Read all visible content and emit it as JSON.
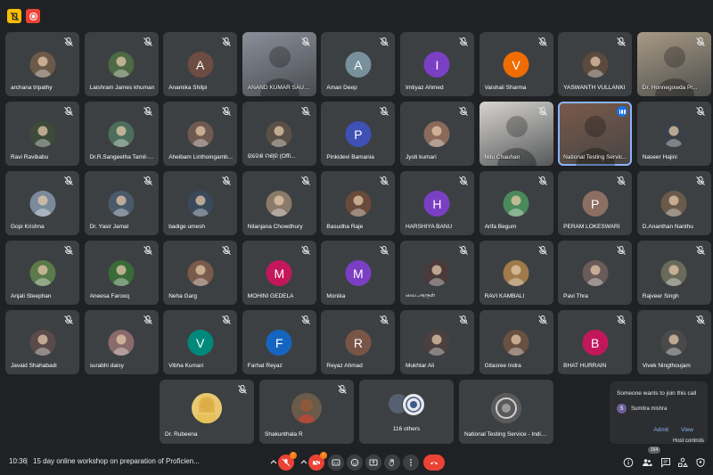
{
  "top_icons": [
    {
      "icon": "raised-hand-slash-icon",
      "color": "#fbbc04"
    },
    {
      "icon": "recording-icon",
      "color": "#ea4335"
    }
  ],
  "participants": [
    {
      "name": "archana tripathy",
      "avatar": "photo",
      "color": "#6b5a48"
    },
    {
      "name": "Laishram James khuman",
      "avatar": "photo",
      "color": "#4c6a44"
    },
    {
      "name": "Anamika Shilpi",
      "avatar": "A",
      "color": "#6d4c41"
    },
    {
      "name": "ANAND KUMAR SAURA...",
      "avatar": "video",
      "color": "#8a8e99"
    },
    {
      "name": "Aman Deep",
      "avatar": "A",
      "color": "#78909c"
    },
    {
      "name": "Imtiyaz Ahmed",
      "avatar": "I",
      "color": "#7b3fc4"
    },
    {
      "name": "Vaishali Sharma",
      "avatar": "V",
      "color": "#ef6c00"
    },
    {
      "name": "YASWANTH VULLANKI",
      "avatar": "photo",
      "color": "#5b4a3d"
    },
    {
      "name": "Dr. Honnegowda Pr...",
      "avatar": "video",
      "color": "#a89a84"
    },
    {
      "name": "Ravi Ravibabu",
      "avatar": "photo",
      "color": "#3e4a3a"
    },
    {
      "name": "Dr.R.Sangeetha Tamil-SF",
      "avatar": "photo",
      "color": "#4c6e5a"
    },
    {
      "name": "Aheibam Linthoingamb...",
      "avatar": "photo",
      "color": "#6e5a50"
    },
    {
      "name": "ରାଜେଶ ମିଶ୍ର (Offi...",
      "avatar": "photo",
      "color": "#5a5045"
    },
    {
      "name": "Pinkidevi Bamania",
      "avatar": "P",
      "color": "#3f51b5"
    },
    {
      "name": "Jyoti kumari",
      "avatar": "photo",
      "color": "#8a6a5a"
    },
    {
      "name": "Nitu Chauhan",
      "avatar": "video",
      "color": "#d7d4d0"
    },
    {
      "name": "National Testing Servic...",
      "avatar": "video",
      "color": "#7a5a4a"
    },
    {
      "name": "Naseer Hajini",
      "avatar": "photo",
      "color": "#3a4048"
    },
    {
      "name": "Gopi Krishna",
      "avatar": "photo",
      "color": "#7a8a9a"
    },
    {
      "name": "Dr. Yasir Jamal",
      "avatar": "photo",
      "color": "#4a5a6a"
    },
    {
      "name": "badige umesh",
      "avatar": "photo",
      "color": "#3a4a5a"
    },
    {
      "name": "Nilanjana Chowdhury",
      "avatar": "photo",
      "color": "#8a7a6a"
    },
    {
      "name": "Basudha Raje",
      "avatar": "photo",
      "color": "#6a4a3a"
    },
    {
      "name": "HARSHIYA BANU",
      "avatar": "H",
      "color": "#7b3fc4"
    },
    {
      "name": "Arifa Begum",
      "avatar": "photo",
      "color": "#4a8a5a"
    },
    {
      "name": "PERAM LOKESWARI",
      "avatar": "P",
      "color": "#8d6e63"
    },
    {
      "name": "D.Ananthan Nanthu",
      "avatar": "photo",
      "color": "#6a5a4a"
    },
    {
      "name": "Anjali Steephan",
      "avatar": "photo",
      "color": "#5a7a4a"
    },
    {
      "name": "Aneesa Farooq",
      "avatar": "photo",
      "color": "#3a6a3a"
    },
    {
      "name": "Neha Garg",
      "avatar": "photo",
      "color": "#7a5a4a"
    },
    {
      "name": "MOHINI GEDELA",
      "avatar": "M",
      "color": "#c2185b"
    },
    {
      "name": "Monika",
      "avatar": "M",
      "color": "#7b3fc4"
    },
    {
      "name": "வை.அருள்",
      "avatar": "photo",
      "color": "#4a3a3a"
    },
    {
      "name": "RAVI KAMBALI",
      "avatar": "photo",
      "color": "#a07a4a"
    },
    {
      "name": "Pavi Thra",
      "avatar": "photo",
      "color": "#6a5a5a"
    },
    {
      "name": "Rajveer Singh",
      "avatar": "photo",
      "color": "#6a6a5a"
    },
    {
      "name": "Javaid Shahabadi",
      "avatar": "photo",
      "color": "#5a4a4a"
    },
    {
      "name": "surabhi daisy",
      "avatar": "photo",
      "color": "#8a6a6a"
    },
    {
      "name": "Vibha Kumari",
      "avatar": "V",
      "color": "#00897b"
    },
    {
      "name": "Farhat Reyaz",
      "avatar": "F",
      "color": "#1565c0"
    },
    {
      "name": "Reyaz Ahmad",
      "avatar": "R",
      "color": "#795548"
    },
    {
      "name": "Mukhtar Ali",
      "avatar": "photo",
      "color": "#4a4040"
    },
    {
      "name": "Gitasree Indra",
      "avatar": "photo",
      "color": "#6a5040"
    },
    {
      "name": "BHAT HURRAIN",
      "avatar": "B",
      "color": "#c2185b"
    },
    {
      "name": "Vivek Ningthoujam",
      "avatar": "photo",
      "color": "#4a4a4a"
    }
  ],
  "bottom_tiles": [
    {
      "name": "Dr. Rubeena",
      "color": "#d6a84a"
    },
    {
      "name": "Shakunthala R",
      "color": "#7a4a3a"
    },
    {
      "name": "116 others",
      "color": "#556070"
    },
    {
      "name": "National Testing Service - India ...",
      "color": "#6a6a6a"
    }
  ],
  "join_request": {
    "title": "Someone wants to join this call",
    "avatar_letter": "S",
    "name": "Sumitra mishra",
    "admit": "Admit",
    "view": "View"
  },
  "tooltip": "Host controls",
  "bottom_bar": {
    "time": "10:36",
    "separator": "|",
    "meeting_title": "15 day online workshop on preparation of Proficien...",
    "participant_count": "164",
    "mic_badge": "!",
    "cam_badge": "!"
  }
}
